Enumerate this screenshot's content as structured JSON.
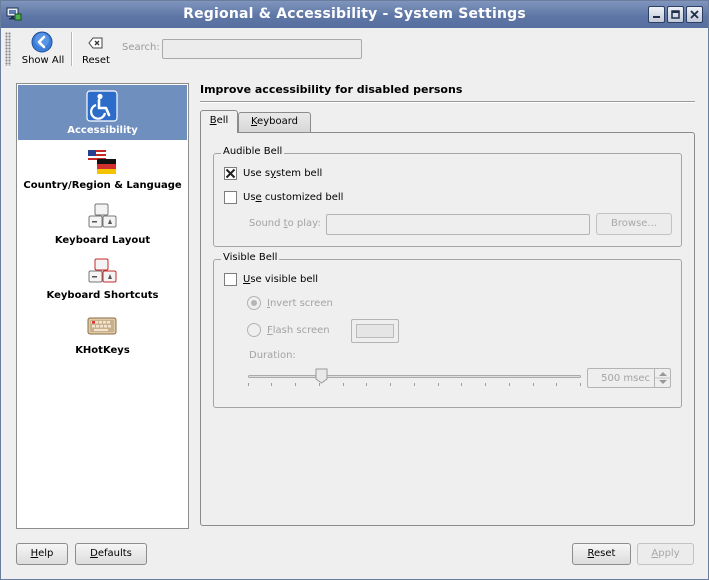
{
  "window": {
    "title": "Regional & Accessibility - System Settings",
    "controls": [
      "minimize",
      "maximize",
      "close"
    ]
  },
  "toolbar": {
    "show_all_label": "Show All",
    "reset_label": "Reset",
    "search_label": "Search:",
    "search_value": ""
  },
  "sidebar": {
    "items": [
      {
        "label": "Accessibility",
        "icon": "accessibility-icon",
        "selected": true
      },
      {
        "label": "Country/Region & Language",
        "icon": "flags-icon",
        "selected": false
      },
      {
        "label": "Keyboard Layout",
        "icon": "keyboard-layout-icon",
        "selected": false
      },
      {
        "label": "Keyboard Shortcuts",
        "icon": "keyboard-shortcuts-icon",
        "selected": false
      },
      {
        "label": "KHotKeys",
        "icon": "khotkeys-icon",
        "selected": false
      }
    ]
  },
  "main": {
    "heading": "Improve accessibility for disabled persons",
    "tabs": [
      {
        "label": "Bell",
        "mnemonic": "B",
        "active": true
      },
      {
        "label": "Keyboard",
        "mnemonic": "K",
        "active": false
      }
    ],
    "audible_bell": {
      "title": "Audible Bell",
      "use_system_bell": {
        "label": "Use system bell",
        "checked": true
      },
      "use_customized_bell": {
        "label": "Use customized bell",
        "checked": false
      },
      "sound_label": "Sound to play:",
      "sound_value": "",
      "browse_label": "Browse..."
    },
    "visible_bell": {
      "title": "Visible Bell",
      "use_visible_bell": {
        "label": "Use visible bell",
        "checked": false
      },
      "invert_screen_label": "Invert screen",
      "flash_screen_label": "Flash screen",
      "duration_label": "Duration:",
      "duration_value": "500 msec",
      "duration_slider_fraction": 0.22
    }
  },
  "footer": {
    "help_label": "Help",
    "defaults_label": "Defaults",
    "reset_label": "Reset",
    "apply_label": "Apply"
  },
  "colors": {
    "titlebar": "#5f77a6",
    "selection": "#6f8fbe",
    "window_bg": "#efefef"
  }
}
